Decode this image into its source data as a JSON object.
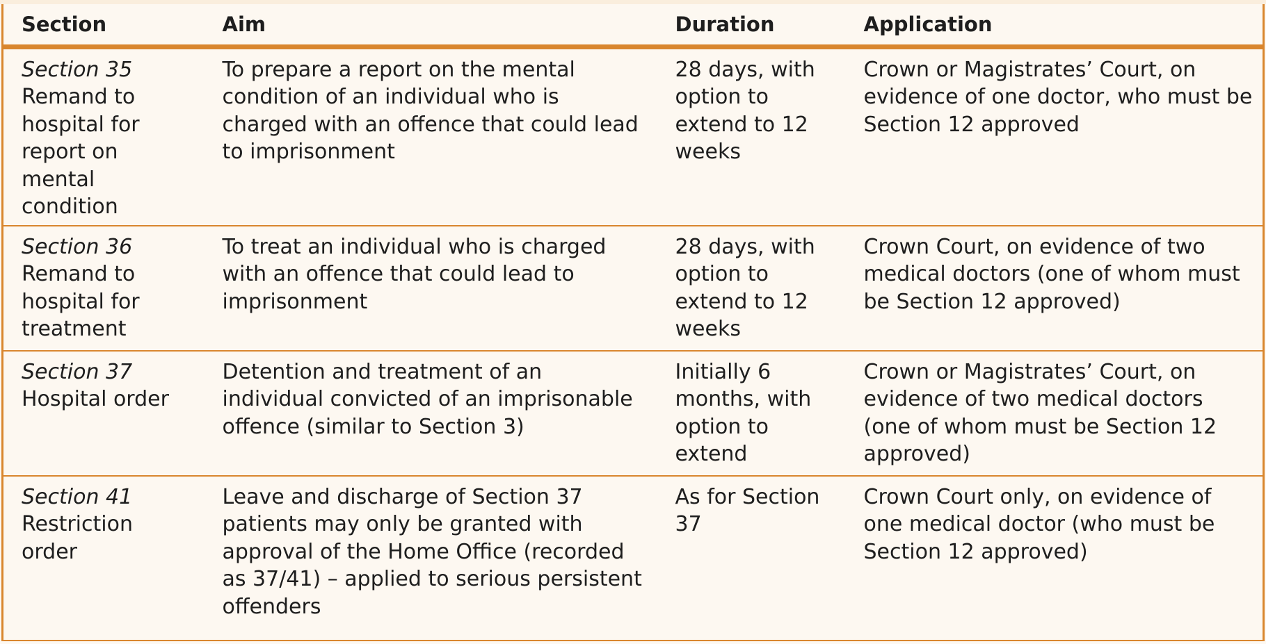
{
  "table": {
    "headers": [
      "Section",
      "Aim",
      "Duration",
      "Application"
    ],
    "rows": [
      {
        "section": "Section 35",
        "section_desc": "Remand to hospital for report on mental condition",
        "aim": "To prepare a report on the mental condition of an individual who is charged with an offence that could lead to imprisonment",
        "duration": "28 days, with option to extend to 12 weeks",
        "application": "Crown or Magistrates’ Court, on evidence of one doctor, who must be Section 12 approved"
      },
      {
        "section": "Section 36",
        "section_desc": "Remand to hospital for treatment",
        "aim": "To treat an individual who is charged with an offence that could lead to imprisonment",
        "duration": "28 days, with option to extend to 12 weeks",
        "application": "Crown Court, on evidence of two medical doctors (one of whom must be Section 12 approved)"
      },
      {
        "section": "Section 37",
        "section_desc": "Hospital order",
        "aim": "Detention and treatment of an individual convicted of an imprisonable offence (similar to Section 3)",
        "duration": "Initially 6 months, with option to extend",
        "application": "Crown or Magistrates’ Court, on evidence of two medical doctors (one of whom must be Section 12 approved)"
      },
      {
        "section": "Section 41",
        "section_desc": "Restriction order",
        "aim": "Leave and discharge of Section 37 patients may only be granted with approval of the Home Office (recorded as 37/41) – applied to serious persistent offenders",
        "duration": "As for Section 37",
        "application": "Crown Court only, on evidence of one medical doctor (who must be Section 12 approved)"
      }
    ]
  },
  "colors": {
    "accent": "#d9862e",
    "background": "#fdf8f1",
    "top_band": "#faeedd",
    "text": "#1e1e1e"
  }
}
